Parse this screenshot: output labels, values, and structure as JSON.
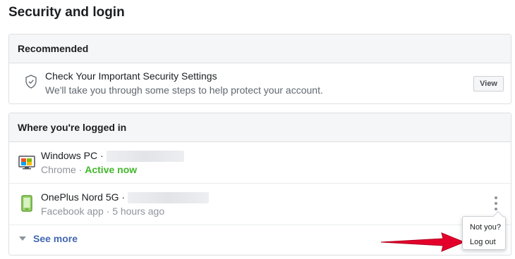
{
  "page": {
    "title": "Security and login"
  },
  "recommended": {
    "header": "Recommended",
    "title": "Check Your Important Security Settings",
    "subtitle": "We'll take you through some steps to help protect your account.",
    "view_label": "View"
  },
  "sessions": {
    "header": "Where you're logged in",
    "items": [
      {
        "device": "Windows PC ·",
        "app": "Chrome",
        "separator": " · ",
        "status": "Active now",
        "icon": "desktop-icon"
      },
      {
        "device": "OnePlus Nord 5G ·",
        "app": "Facebook app",
        "separator": " · ",
        "status": "5 hours ago",
        "icon": "phone-icon"
      }
    ],
    "see_more": "See more"
  },
  "menu": {
    "not_you": "Not you?",
    "log_out": "Log out"
  },
  "colors": {
    "active": "#42b72a",
    "link": "#4267b2",
    "arrow": "#e4002b"
  }
}
